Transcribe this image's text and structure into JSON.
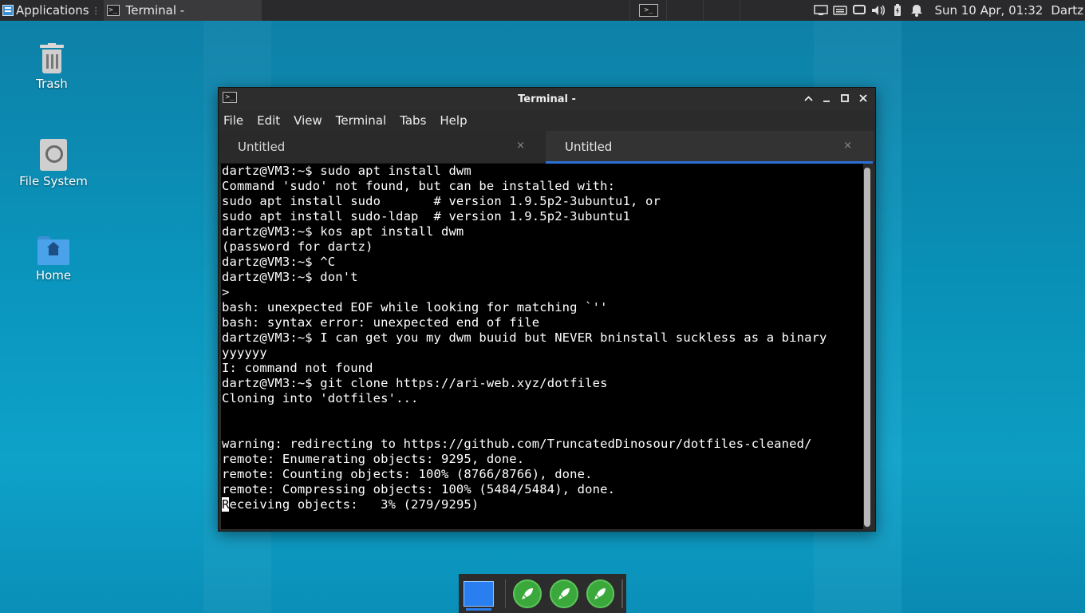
{
  "top_panel": {
    "applications_label": "Applications",
    "task_title": "Terminal -",
    "clock": "Sun 10 Apr, 01:32",
    "user": "Dartz"
  },
  "desktop": {
    "icons": [
      {
        "label": "Trash"
      },
      {
        "label": "File System"
      },
      {
        "label": "Home"
      }
    ]
  },
  "window": {
    "title": "Terminal -",
    "menu": [
      "File",
      "Edit",
      "View",
      "Terminal",
      "Tabs",
      "Help"
    ],
    "tabs": [
      {
        "label": "Untitled",
        "close": "×"
      },
      {
        "label": "Untitled",
        "close": "×"
      }
    ],
    "terminal_lines": [
      "dartz@VM3:~$ sudo apt install dwm",
      "Command 'sudo' not found, but can be installed with:",
      "sudo apt install sudo       # version 1.9.5p2-3ubuntu1, or",
      "sudo apt install sudo-ldap  # version 1.9.5p2-3ubuntu1",
      "dartz@VM3:~$ kos apt install dwm",
      "(password for dartz)",
      "dartz@VM3:~$ ^C",
      "dartz@VM3:~$ don't",
      "> ",
      "bash: unexpected EOF while looking for matching `''",
      "bash: syntax error: unexpected end of file",
      "dartz@VM3:~$ I can get you my dwm buuid but NEVER bninstall suckless as a binary",
      "yyyyyy",
      "I: command not found",
      "dartz@VM3:~$ git clone https://ari-web.xyz/dotfiles",
      "Cloning into 'dotfiles'...",
      "",
      "",
      "warning: redirecting to https://github.com/TruncatedDinosour/dotfiles-cleaned/",
      "remote: Enumerating objects: 9295, done.",
      "remote: Counting objects: 100% (8766/8766), done.",
      "remote: Compressing objects: 100% (5484/5484), done."
    ],
    "cursor_char": "R",
    "last_line_rest": "eceiving objects:   3% (279/9295)"
  },
  "colors": {
    "accent": "#2e6fd6",
    "desktop": "#0a95bd",
    "terminal_bg": "#000000",
    "dock_launcher": "#3aa83a"
  }
}
